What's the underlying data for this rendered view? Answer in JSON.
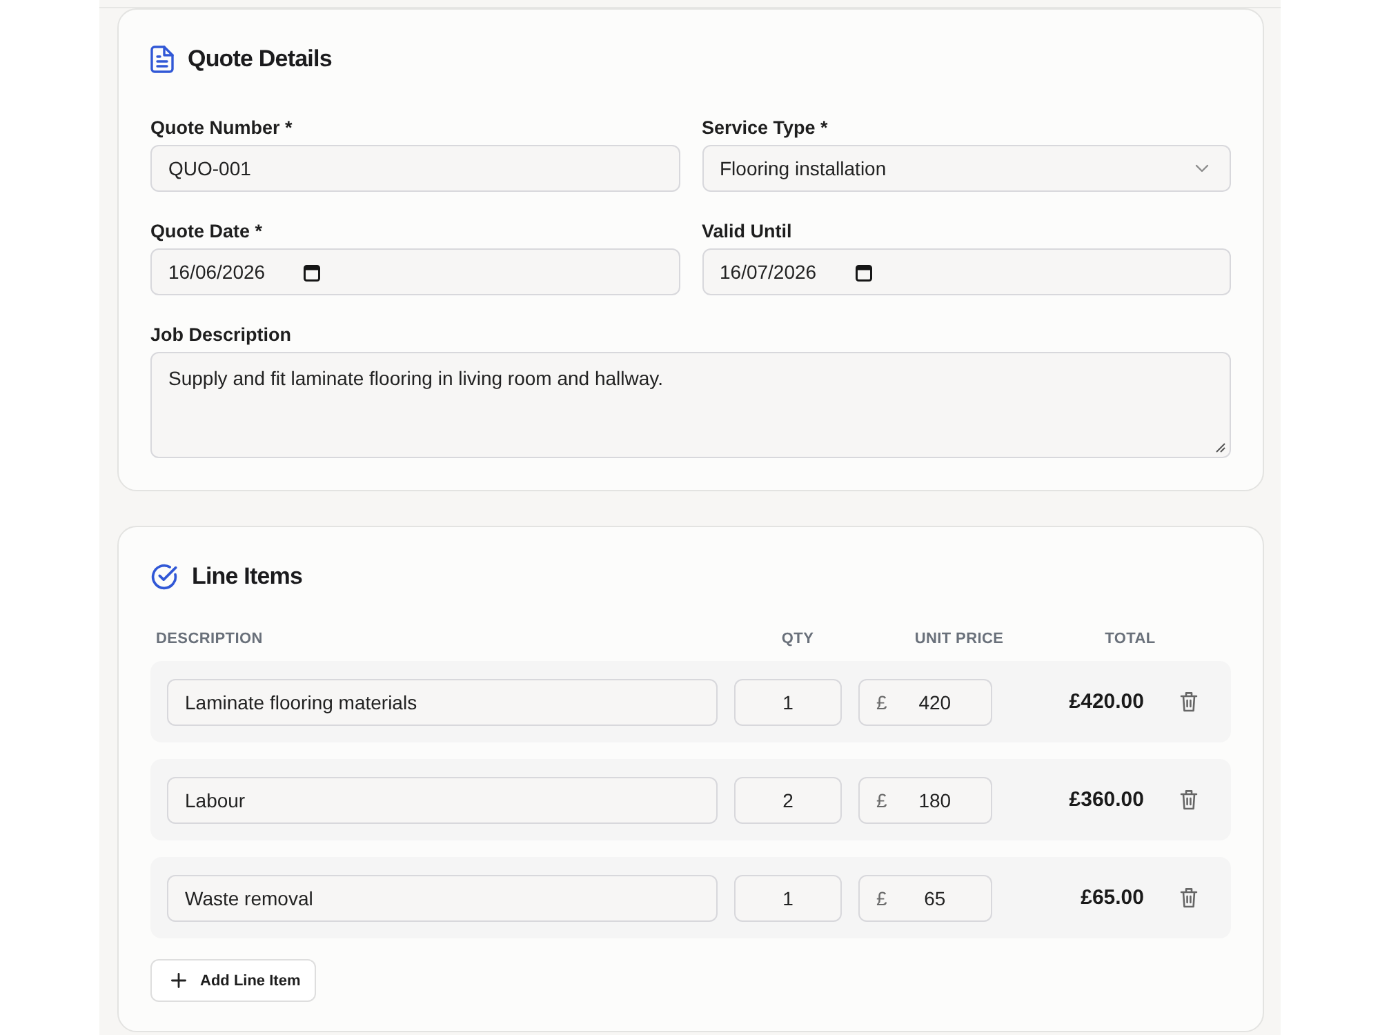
{
  "quote_details": {
    "title": "Quote Details",
    "fields": [
      {
        "kind": "text",
        "label": "Quote Number *",
        "value": "QUO-001"
      },
      {
        "kind": "select",
        "label": "Service Type *",
        "value": "Flooring installation"
      },
      {
        "kind": "date",
        "label": "Quote Date *",
        "value": "16/06/2026"
      },
      {
        "kind": "date",
        "label": "Valid Until",
        "value": "16/07/2026"
      },
      {
        "kind": "textarea",
        "label": "Job Description",
        "value": "Supply and fit laminate flooring in living room and hallway."
      }
    ]
  },
  "line_items": {
    "title": "Line Items",
    "columns": [
      "DESCRIPTION",
      "QTY",
      "UNIT PRICE",
      "TOTAL"
    ],
    "rows": [
      {
        "description": "Laminate flooring materials",
        "qty": "1",
        "currency": "£",
        "unit_price": "420",
        "total": "£420.00"
      },
      {
        "description": "Labour",
        "qty": "2",
        "currency": "£",
        "unit_price": "180",
        "total": "£360.00"
      },
      {
        "description": "Waste removal",
        "qty": "1",
        "currency": "£",
        "unit_price": "65",
        "total": "£65.00"
      }
    ],
    "add_button": "Add Line Item"
  }
}
